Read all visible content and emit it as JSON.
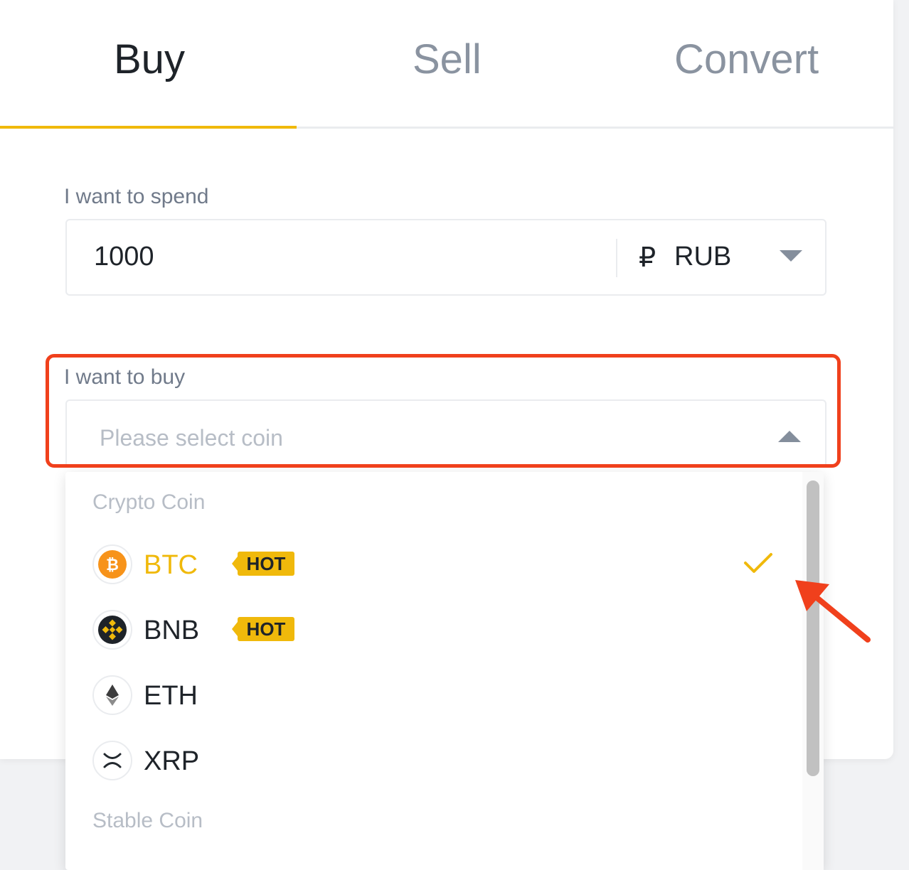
{
  "tabs": [
    {
      "label": "Buy",
      "active": true
    },
    {
      "label": "Sell",
      "active": false
    },
    {
      "label": "Convert",
      "active": false
    }
  ],
  "spend": {
    "label": "I want to spend",
    "value": "1000",
    "currency_symbol": "₽",
    "currency": "RUB"
  },
  "buy": {
    "label": "I want to buy",
    "placeholder": "Please select coin"
  },
  "dropdown": {
    "groups": [
      {
        "label": "Crypto Coin"
      },
      {
        "label": "Stable Coin"
      }
    ],
    "coins": [
      {
        "name": "BTC",
        "badge": "HOT",
        "selected": true,
        "icon": "bitcoin-icon"
      },
      {
        "name": "BNB",
        "badge": "HOT",
        "selected": false,
        "icon": "bnb-icon"
      },
      {
        "name": "ETH",
        "badge": "",
        "selected": false,
        "icon": "ethereum-icon"
      },
      {
        "name": "XRP",
        "badge": "",
        "selected": false,
        "icon": "xrp-icon"
      }
    ]
  },
  "colors": {
    "accent": "#f0b90b",
    "highlight": "#f0401c",
    "text": "#1e2329",
    "muted": "#707a8a"
  }
}
